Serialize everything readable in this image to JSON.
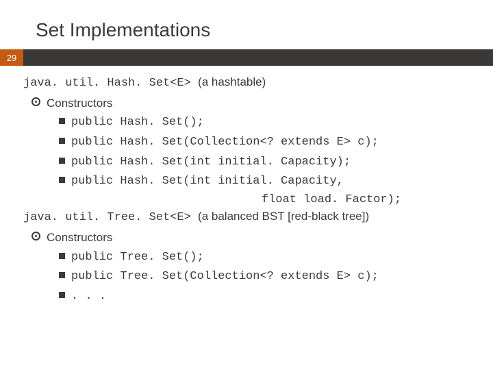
{
  "title": "Set Implementations",
  "slide_number": "29",
  "sections": [
    {
      "class_name": "java. util. Hash. Set<E> ",
      "description": "(a hashtable)",
      "subheading": "Constructors",
      "constructors": [
        "public Hash. Set();",
        "public Hash. Set(Collection<? extends E> c);",
        "public Hash. Set(int initial. Capacity);",
        "public Hash. Set(int initial. Capacity,"
      ],
      "constructors_cont": "float load. Factor);"
    },
    {
      "class_name": "java. util. Tree. Set<E> ",
      "description": "(a balanced BST [red-black tree])",
      "subheading": "Constructors",
      "constructors": [
        "public Tree. Set();",
        "public Tree. Set(Collection<? extends E> c);",
        ". . ."
      ]
    }
  ]
}
